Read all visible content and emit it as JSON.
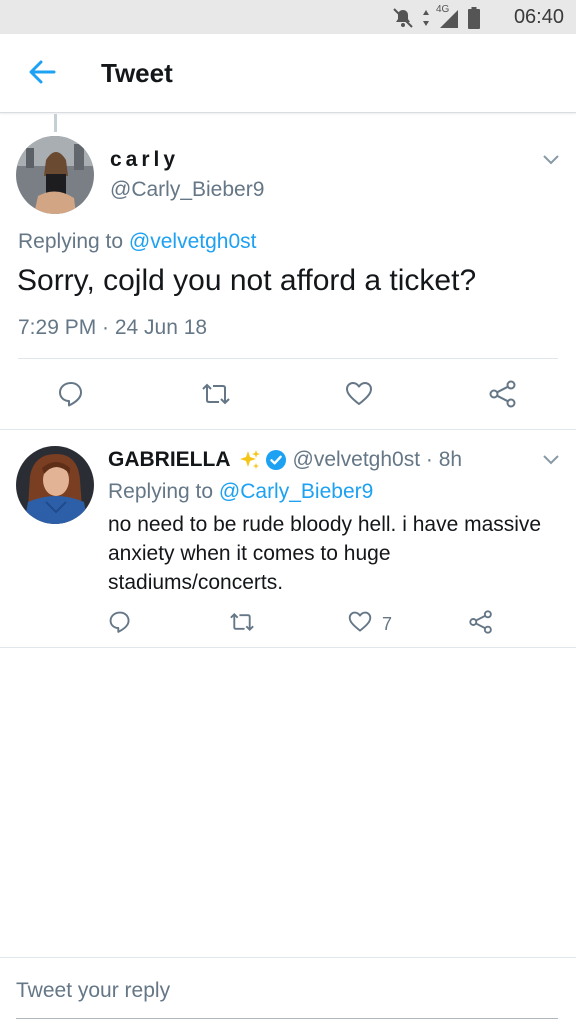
{
  "status_bar": {
    "time": "06:40",
    "network": "4G",
    "icons": [
      "mute-icon",
      "data-arrows-icon",
      "signal-icon",
      "battery-icon"
    ]
  },
  "header": {
    "title": "Tweet",
    "back_icon": "back-arrow-icon"
  },
  "main_tweet": {
    "display_name": "carly",
    "handle": "@Carly_Bieber9",
    "replying_prefix": "Replying to",
    "replying_to": "@velvetgh0st",
    "text": "Sorry, cojld you not afford a ticket?",
    "timestamp": "7:29 PM · 24 Jun 18",
    "actions": [
      "reply-icon",
      "retweet-icon",
      "like-icon",
      "share-icon"
    ]
  },
  "reply_tweet": {
    "display_name": "GABRIELLA",
    "emoji": "sparkles-icon",
    "verified": true,
    "handle_time": "@velvetgh0st · 8h",
    "replying_prefix": "Replying to",
    "replying_to": "@Carly_Bieber9",
    "text": "no need to be rude bloody hell. i have massive anxiety when it comes to huge stadiums/concerts.",
    "like_count": "7",
    "actions": [
      "reply-icon",
      "retweet-icon",
      "like-icon",
      "share-icon"
    ]
  },
  "composer": {
    "placeholder": "Tweet your reply"
  },
  "colors": {
    "accent": "#1da1f2",
    "secondary_text": "#657786",
    "primary_text": "#14171a",
    "status_bar_bg": "#e8e8e8",
    "verified": "#1da1f2",
    "sparkle": "#f5c518"
  }
}
